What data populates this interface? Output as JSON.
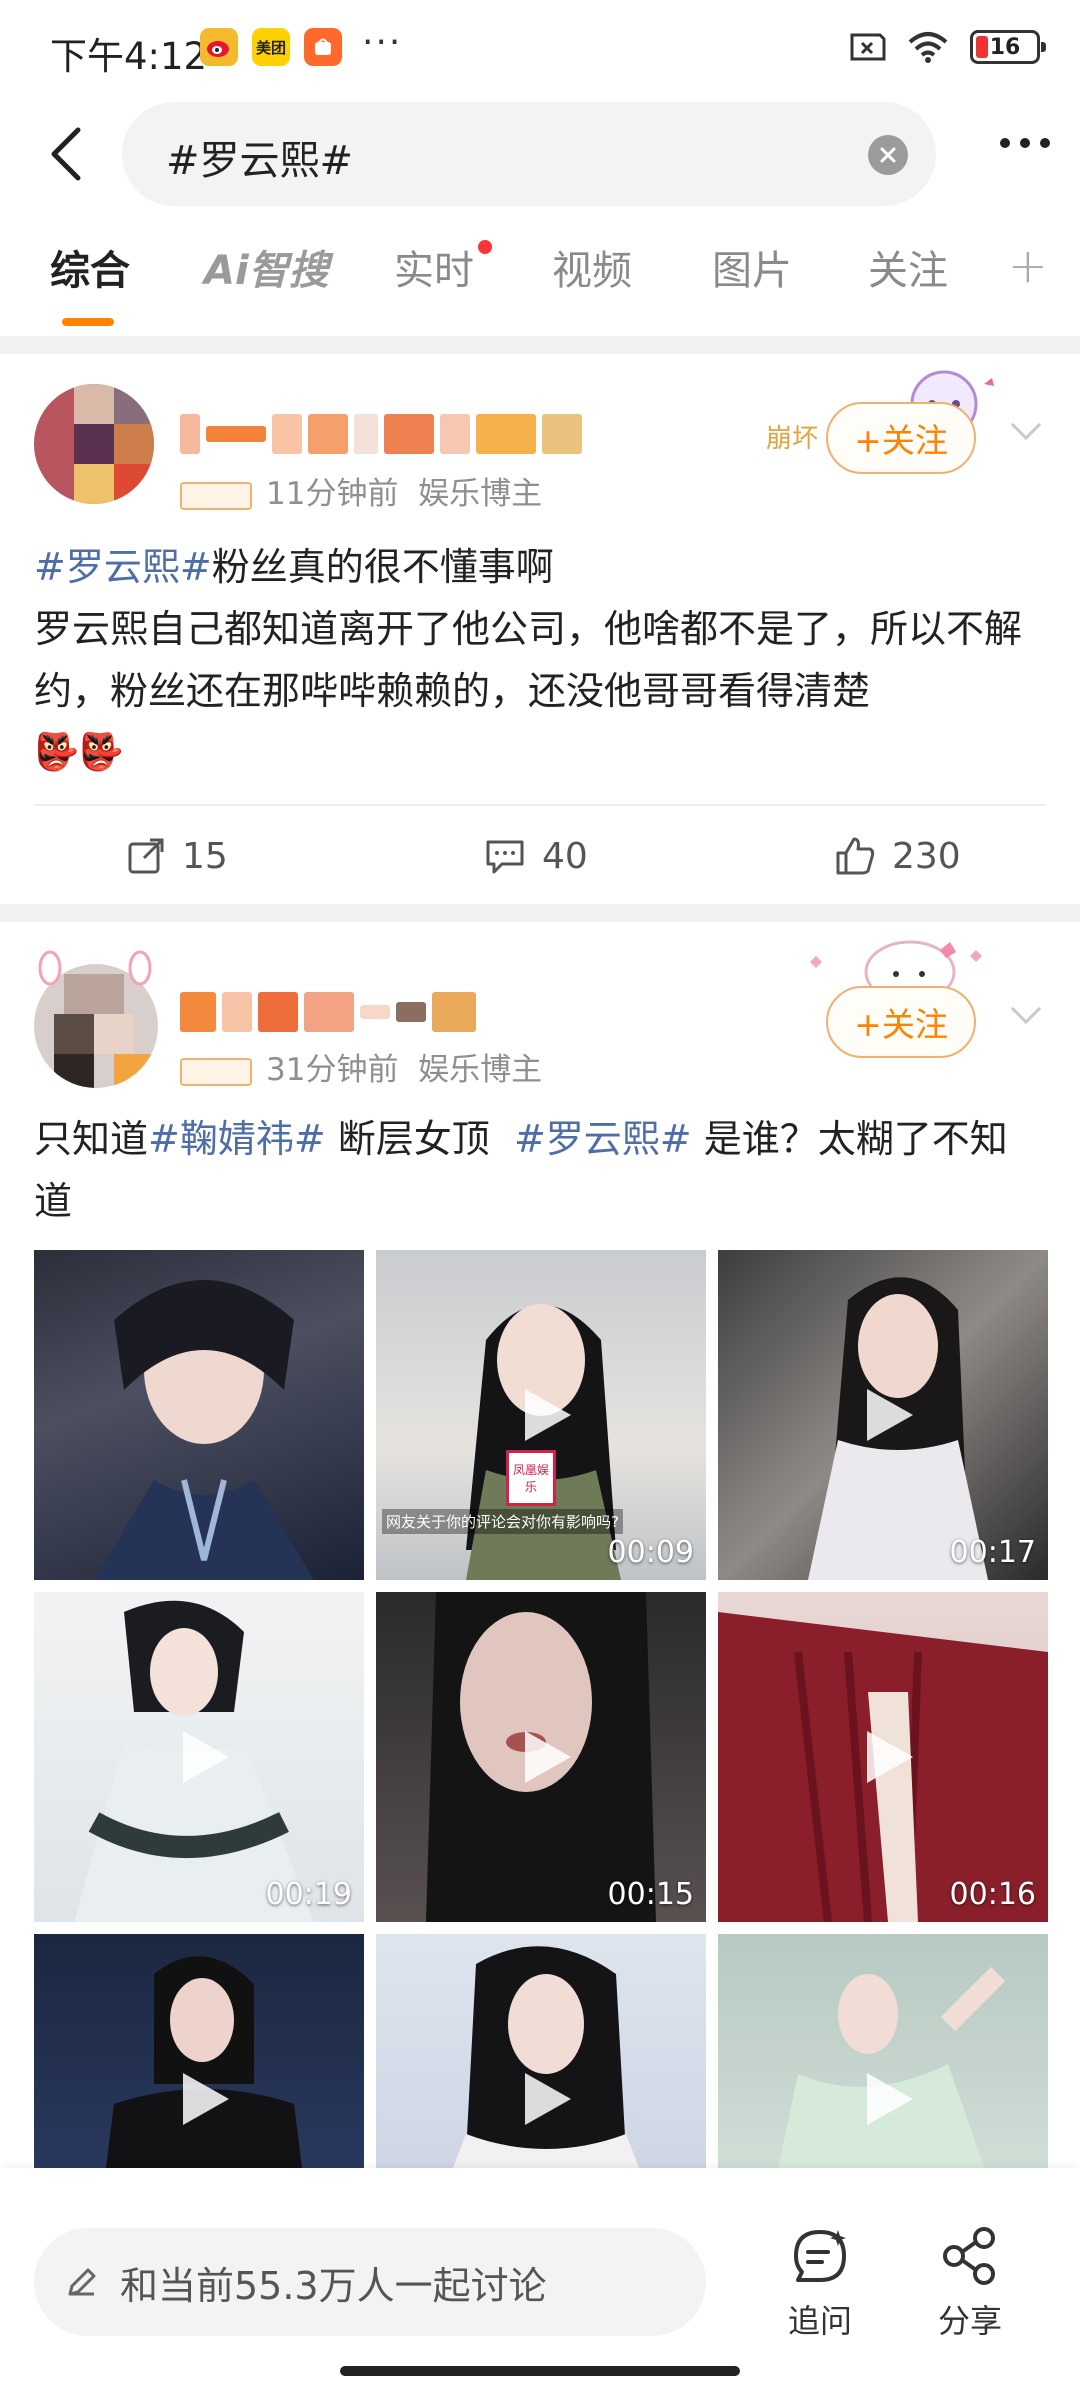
{
  "status": {
    "time": "下午4:12",
    "apps": [
      "weibo-badge",
      "meituan-badge",
      "taobao-badge"
    ],
    "app_labels": [
      "",
      "美团",
      ""
    ],
    "more": "···",
    "battery": "16"
  },
  "search": {
    "query": "#罗云熙#"
  },
  "tabs": [
    {
      "label": "综合",
      "active": true
    },
    {
      "label": "Ai智搜"
    },
    {
      "label": "实时",
      "dot": true
    },
    {
      "label": "视频"
    },
    {
      "label": "图片"
    },
    {
      "label": "关注"
    }
  ],
  "posts": [
    {
      "time": "11分钟前",
      "category": "娱乐博主",
      "follow_label": "+关注",
      "badge_text": "崩坏",
      "topic": "#罗云熙#",
      "title_rest": "粉丝真的很不懂事啊",
      "body": "罗云熙自己都知道离开了他公司，他啥都不是了，所以不解约，粉丝还在那哔哔赖赖的，还没他哥哥看得清楚",
      "emoji": "👺👺",
      "reposts": "15",
      "comments": "40",
      "likes": "230"
    },
    {
      "time": "31分钟前",
      "category": "娱乐博主",
      "follow_label": "+关注",
      "text_a": "只知道",
      "topic_a": "#鞠婧祎#",
      "text_b": " 断层女顶  ",
      "topic_b": "#罗云熙#",
      "text_c": " 是谁？太糊了不知道",
      "media": [
        {
          "duration": ""
        },
        {
          "duration": "00:09",
          "caption": "网友关于你的评论会对你有影响吗?",
          "mic": "凤凰娱乐"
        },
        {
          "duration": "00:17"
        },
        {
          "duration": "00:19"
        },
        {
          "duration": "00:15"
        },
        {
          "duration": "00:16"
        },
        {
          "duration": ""
        },
        {
          "duration": ""
        },
        {
          "duration": ""
        }
      ]
    }
  ],
  "bottom": {
    "discuss_placeholder": "和当前55.3万人一起讨论",
    "ask_label": "追问",
    "share_label": "分享"
  },
  "colors": {
    "accent": "#ff8200",
    "topic": "#4e6ea8",
    "red_dot": "#ff3333"
  }
}
